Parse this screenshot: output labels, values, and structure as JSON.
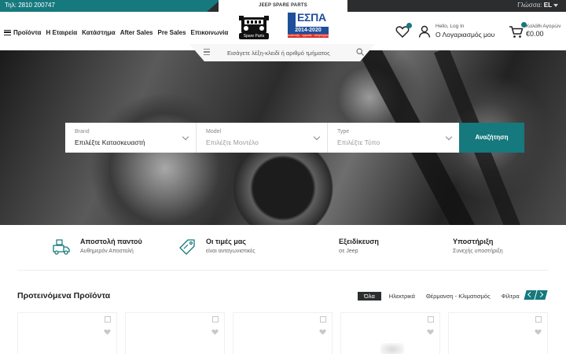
{
  "topbar": {
    "phone": "Τηλ: 2810 200747",
    "language_label": "Γλώσσα:",
    "language_value": "EL"
  },
  "brand": {
    "tagline": "JEEP SPARE PARTS",
    "logo_text": "Spare Parts",
    "espa_title": "ΕΣΠΑ",
    "espa_years": "2014-2020",
    "espa_sub": "ανάπτυξη · εργασία · αλληλεγγύη"
  },
  "nav": {
    "items": [
      "Προϊόντα",
      "Η Εταιρεία",
      "Κατάστημα",
      "After Sales",
      "Pre Sales",
      "Επικοινωνία"
    ]
  },
  "header": {
    "hello": "Hello, Log In",
    "account": "Ο Λογαριασμός μου",
    "cart_label": "Καλάθι Αγορών",
    "cart_total": "€0.00"
  },
  "search": {
    "placeholder": "Εισάγετε λέξη-κλειδί ή αριθμό τμήματος"
  },
  "filter": {
    "brand_label": "Brand",
    "brand_value": "Επιλέξτε Κατασκευαστή",
    "model_label": "Model",
    "model_value": "Επιλέξτε Μοντέλο",
    "type_label": "Type",
    "type_value": "Επιλέξτε Τύπο",
    "submit": "Αναζήτηση"
  },
  "features": [
    {
      "title": "Αποστολή παντού",
      "sub": "Αυθημερόν Αποστολή",
      "icon": "truck-icon"
    },
    {
      "title": "Οι τιμές μας",
      "sub": "είναι ανταγωνιστικές",
      "icon": "price-tag-icon"
    },
    {
      "title": "Εξειδίκευση",
      "sub": "σε Jeep",
      "icon": ""
    },
    {
      "title": "Υποστήριξη",
      "sub": "Συνεχής υποστήριξη",
      "icon": ""
    }
  ],
  "featured": {
    "title": "Προτεινόμενα Προϊόντα",
    "tabs": [
      "Όλα",
      "Ηλεκτρικά",
      "Θέρμανση - Κλιματισμός",
      "Φίλτρα"
    ]
  },
  "colors": {
    "accent": "#16797e",
    "dark": "#2b2d2f"
  }
}
